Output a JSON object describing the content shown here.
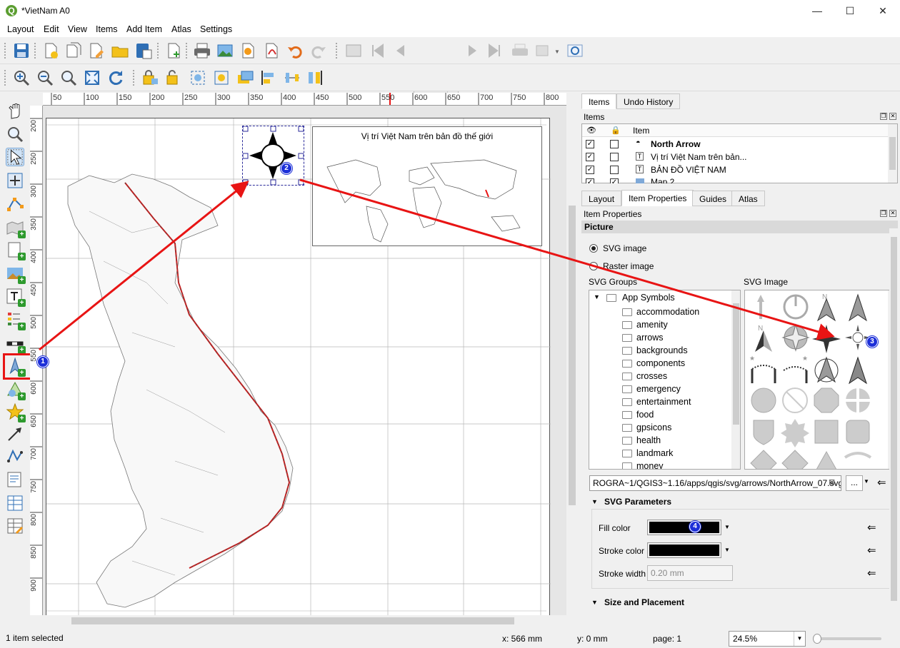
{
  "window": {
    "title": "*VietNam A0",
    "minimize": "—",
    "maximize": "☐",
    "close": "✕"
  },
  "menu": [
    "Layout",
    "Edit",
    "View",
    "Items",
    "Add Item",
    "Atlas",
    "Settings"
  ],
  "toolbar": {
    "page_value": "1"
  },
  "rulers": {
    "h": [
      "50",
      "100",
      "150",
      "200",
      "250",
      "300",
      "350",
      "400",
      "450",
      "500",
      "550",
      "600",
      "650",
      "700",
      "750",
      "800"
    ],
    "v": [
      "200",
      "250",
      "300",
      "350",
      "400",
      "450",
      "500",
      "550",
      "600",
      "650",
      "700",
      "750",
      "800",
      "850",
      "900"
    ]
  },
  "map": {
    "inset_title": "Vị trí Việt Nam trên bản đồ thế giới"
  },
  "markers": [
    "1",
    "2",
    "3",
    "4"
  ],
  "right": {
    "top_tabs": [
      "Items",
      "Undo History"
    ],
    "items_title": "Items",
    "items_header": "Item",
    "items": [
      {
        "label": "North Arrow",
        "icon": "north-arrow-icon",
        "bold": true,
        "locked": false
      },
      {
        "label": "Vị trí Việt Nam trên bản...",
        "icon": "text-label-icon",
        "locked": false
      },
      {
        "label": "BẢN ĐỒ VIỆT NAM",
        "icon": "text-label-icon",
        "locked": false
      },
      {
        "label": "Map 2",
        "icon": "map-item-icon",
        "locked": true
      }
    ],
    "props_tabs": [
      "Layout",
      "Item Properties",
      "Guides",
      "Atlas"
    ],
    "props_title": "Item Properties",
    "section": "Picture",
    "svg_image_label": "SVG image",
    "raster_image_label": "Raster image",
    "svg_groups_label": "SVG Groups",
    "svg_image_header": "SVG Image",
    "groups_root": "App Symbols",
    "groups": [
      "accommodation",
      "amenity",
      "arrows",
      "backgrounds",
      "components",
      "crosses",
      "emergency",
      "entertainment",
      "food",
      "gpsicons",
      "health",
      "landmark",
      "money"
    ],
    "path": "ROGRA~1/QGIS3~1.16/apps/qgis/svg/arrows/NorthArrow_07.svg",
    "browse": "...",
    "svg_params_title": "SVG Parameters",
    "fill_color_label": "Fill color",
    "stroke_color_label": "Stroke color",
    "stroke_width_label": "Stroke width",
    "stroke_width_value": "0.20 mm",
    "fill_color": "#000000",
    "stroke_color": "#000000",
    "size_placement_title": "Size and Placement"
  },
  "status": {
    "selection": "1 item selected",
    "x": "x: 566 mm",
    "y": "y: 0 mm",
    "page": "page: 1",
    "zoom": "24.5%"
  }
}
